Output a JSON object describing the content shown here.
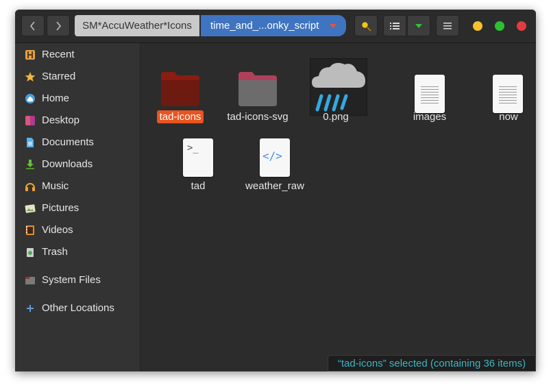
{
  "toolbar": {
    "back_icon": "chevron-left-icon",
    "forward_icon": "chevron-right-icon",
    "search_icon": "search-icon",
    "view_icon": "list-view-icon",
    "view_options_icon": "triangle-down-icon",
    "menu_icon": "hamburger-icon"
  },
  "breadcrumbs": [
    {
      "label": "SM*AccuWeather*Icons"
    },
    {
      "label": "time_and_...onky_script"
    }
  ],
  "window_controls": {
    "minimize_color": "#f6c02e",
    "maximize_color": "#2dc02f",
    "close_color": "#e23c3c"
  },
  "sidebar": {
    "items": [
      {
        "label": "Recent",
        "icon": "recent-icon"
      },
      {
        "label": "Starred",
        "icon": "star-icon"
      },
      {
        "label": "Home",
        "icon": "home-icon"
      },
      {
        "label": "Desktop",
        "icon": "desktop-icon"
      },
      {
        "label": "Documents",
        "icon": "documents-icon"
      },
      {
        "label": "Downloads",
        "icon": "downloads-icon"
      },
      {
        "label": "Music",
        "icon": "music-icon"
      },
      {
        "label": "Pictures",
        "icon": "pictures-icon"
      },
      {
        "label": "Videos",
        "icon": "videos-icon"
      },
      {
        "label": "Trash",
        "icon": "trash-icon"
      },
      {
        "label": "System Files",
        "icon": "system-files-icon"
      },
      {
        "label": "Other Locations",
        "icon": "other-locations-icon"
      }
    ]
  },
  "files": [
    {
      "name": "tad-icons",
      "type": "folder",
      "selected": true
    },
    {
      "name": "tad-icons-svg",
      "type": "folder",
      "selected": false
    },
    {
      "name": "0.png",
      "type": "image",
      "selected": false
    },
    {
      "name": "images",
      "type": "text",
      "selected": false
    },
    {
      "name": "now",
      "type": "text",
      "selected": false
    },
    {
      "name": "tad",
      "type": "script",
      "selected": false
    },
    {
      "name": "weather_raw",
      "type": "html",
      "selected": false
    }
  ],
  "status": {
    "text": "“tad-icons” selected  (containing 36 items)"
  },
  "colors": {
    "accent": "#e95420",
    "breadcrumb_active": "#3f74c0",
    "status_text": "#3fb5c3"
  }
}
